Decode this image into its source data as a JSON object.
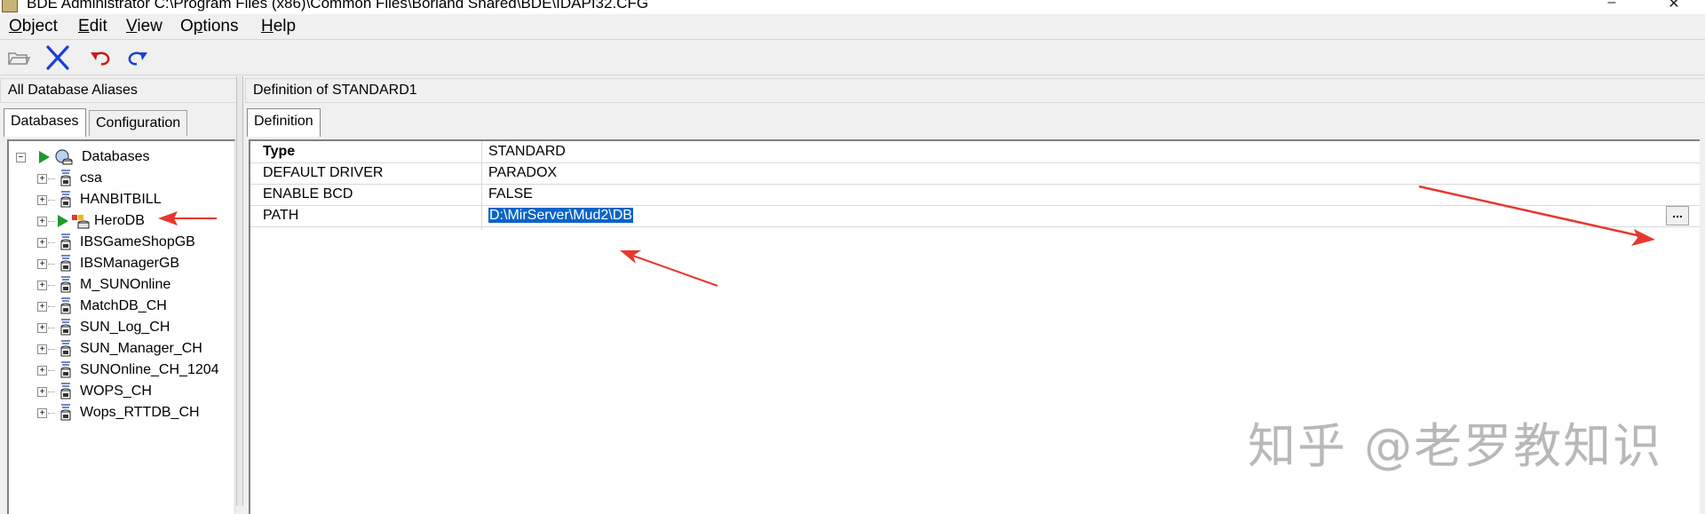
{
  "window": {
    "title": "BDE Administrator  C:\\Program Files (x86)\\Common Files\\Borland Shared\\BDE\\IDAPI32.CFG",
    "minimize_glyph": "–",
    "close_glyph": "✕"
  },
  "menu": [
    {
      "label": "Object",
      "mnemonic": "O",
      "rest": "bject"
    },
    {
      "label": "Edit",
      "mnemonic": "E",
      "rest": "dit"
    },
    {
      "label": "View",
      "mnemonic": "V",
      "rest": "iew"
    },
    {
      "label": "Options",
      "mnemonic": "p",
      "pre": "O",
      "rest": "tions"
    },
    {
      "label": "Help",
      "mnemonic": "H",
      "rest": "elp"
    }
  ],
  "toolbar": {
    "icons": [
      "open-folder-icon",
      "delete-x-icon",
      "undo-icon",
      "redo-icon"
    ]
  },
  "left_panel": {
    "header": "All Database Aliases",
    "tabs": [
      "Databases",
      "Configuration"
    ],
    "tree": {
      "root": "Databases",
      "items": [
        "csa",
        "HANBITBILL",
        "HeroDB",
        "IBSGameShopGB",
        "IBSManagerGB",
        "M_SUNOnline",
        "MatchDB_CH",
        "SUN_Log_CH",
        "SUN_Manager_CH",
        "SUNOnline_CH_1204",
        "WOPS_CH",
        "Wops_RTTDB_CH"
      ]
    }
  },
  "right_panel": {
    "header": "Definition of STANDARD1",
    "tab": "Definition",
    "rows": [
      {
        "key": "Type",
        "value": "STANDARD"
      },
      {
        "key": "DEFAULT DRIVER",
        "value": "PARADOX"
      },
      {
        "key": "ENABLE BCD",
        "value": "FALSE"
      },
      {
        "key": "PATH",
        "value": "D:\\MirServer\\Mud2\\DB"
      }
    ],
    "ellipsis_label": "..."
  },
  "watermark": "知乎 @老罗教知识",
  "colors": {
    "selection": "#0a64c8",
    "annotation_arrow": "#e8372e"
  }
}
